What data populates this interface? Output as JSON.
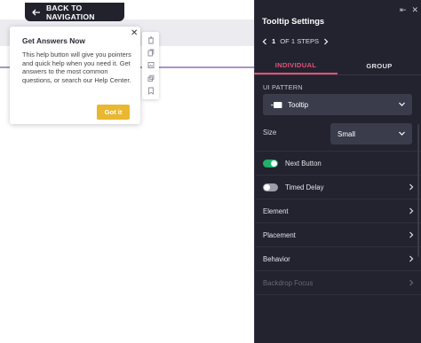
{
  "canvas": {
    "back_nav_label": "BACK TO NAVIGATION",
    "tooltip": {
      "title": "Get Answers Now",
      "body": "This help button will give you pointers and quick help when you need it. Get answers to the most common questions, or search our Help Center.",
      "button_label": "Got it",
      "close_glyph": "✕"
    },
    "mini_toolbar_icons": [
      "trash-icon",
      "copy-icon",
      "image-icon",
      "duplicate-icon",
      "bookmark-icon"
    ]
  },
  "panel": {
    "title": "Tooltip Settings",
    "controls": {
      "collapse_glyph": "⇤",
      "close_glyph": "✕"
    },
    "steps": {
      "current": "1",
      "text": "OF 1 STEPS"
    },
    "tabs": [
      {
        "label": "INDIVIDUAL",
        "active": true
      },
      {
        "label": "GROUP",
        "active": false
      }
    ],
    "ui_pattern": {
      "label": "UI PATTERN",
      "value": "Tooltip"
    },
    "size": {
      "label": "Size",
      "value": "Small"
    },
    "rows": [
      {
        "label": "Next Button",
        "toggle": true
      },
      {
        "label": "Timed Delay",
        "toggle": false
      },
      {
        "label": "Element"
      },
      {
        "label": "Placement"
      },
      {
        "label": "Behavior"
      },
      {
        "label": "Backdrop Focus",
        "disabled": true
      }
    ]
  },
  "colors": {
    "panel_bg": "#22232e",
    "accent_tab": "#e8507a",
    "toggle_on": "#1fb069",
    "button_yellow": "#e9b730",
    "canvas_line": "#a796c9"
  }
}
